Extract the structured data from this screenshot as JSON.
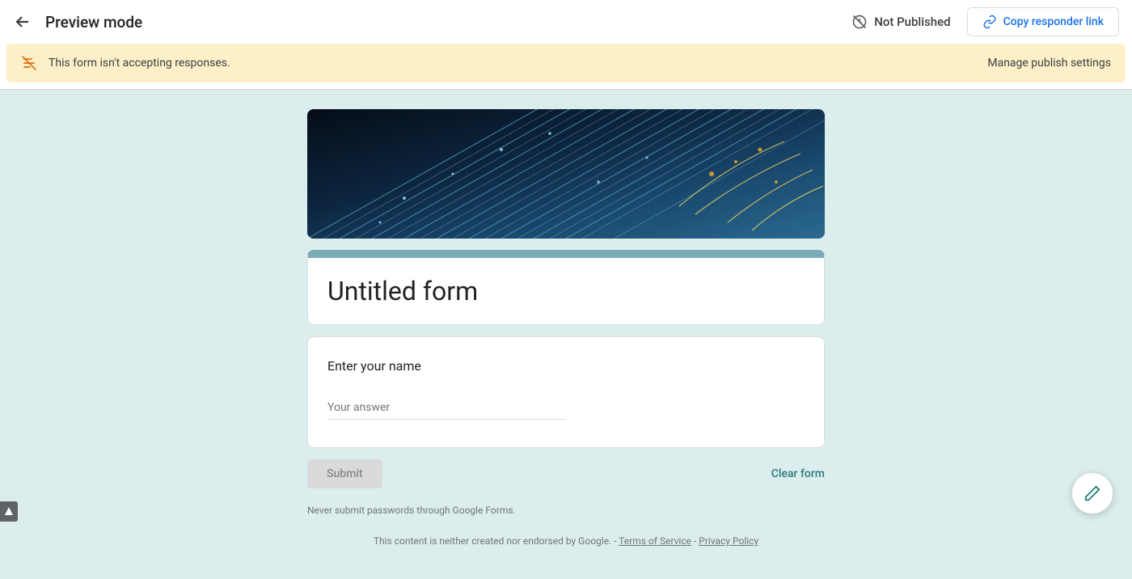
{
  "header": {
    "title": "Preview mode",
    "publish_status": "Not Published",
    "copy_link_label": "Copy responder link"
  },
  "banner": {
    "message": "This form isn't accepting responses.",
    "action_label": "Manage publish settings"
  },
  "form": {
    "title": "Untitled form",
    "question_label": "Enter your name",
    "answer_placeholder": "Your answer",
    "submit_label": "Submit",
    "clear_label": "Clear form"
  },
  "footer": {
    "password_warning": "Never submit passwords through Google Forms.",
    "disclaimer_prefix": "This content is neither created nor endorsed by Google. - ",
    "terms_label": "Terms of Service",
    "separator": " - ",
    "privacy_label": "Privacy Policy"
  },
  "colors": {
    "accent": "#7aacb7",
    "link": "#1a73e8",
    "banner_bg": "#fdefc8",
    "body_bg": "#dceded"
  }
}
